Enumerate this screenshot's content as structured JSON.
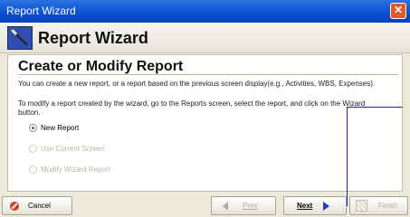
{
  "window": {
    "title": "Report Wizard",
    "close_icon": "close-icon"
  },
  "header": {
    "title": "Report Wizard",
    "icon": "wand-icon"
  },
  "content": {
    "title": "Create or Modify Report",
    "desc1": "You can create a new report, or a report based on the previous screen display(e.g., Activities, WBS, Expenses).",
    "desc2": "To modify a report created by the wizard, go to the Reports screen, select the report, and click on the Wizard",
    "desc2_cont": "button.",
    "options": [
      {
        "label": "New Report",
        "selected": true,
        "enabled": true
      },
      {
        "label": "Use Current Screen",
        "selected": false,
        "enabled": false
      },
      {
        "label": "Modify Wizard Report",
        "selected": false,
        "enabled": false
      }
    ]
  },
  "footer": {
    "cancel": "Cancel",
    "prev": "Prev",
    "next": "Next",
    "finish": "Finish"
  },
  "colors": {
    "titlebar": "#0a4fd0",
    "callout": "#1a2a9a",
    "selected_radio": "#1b8f2f"
  }
}
